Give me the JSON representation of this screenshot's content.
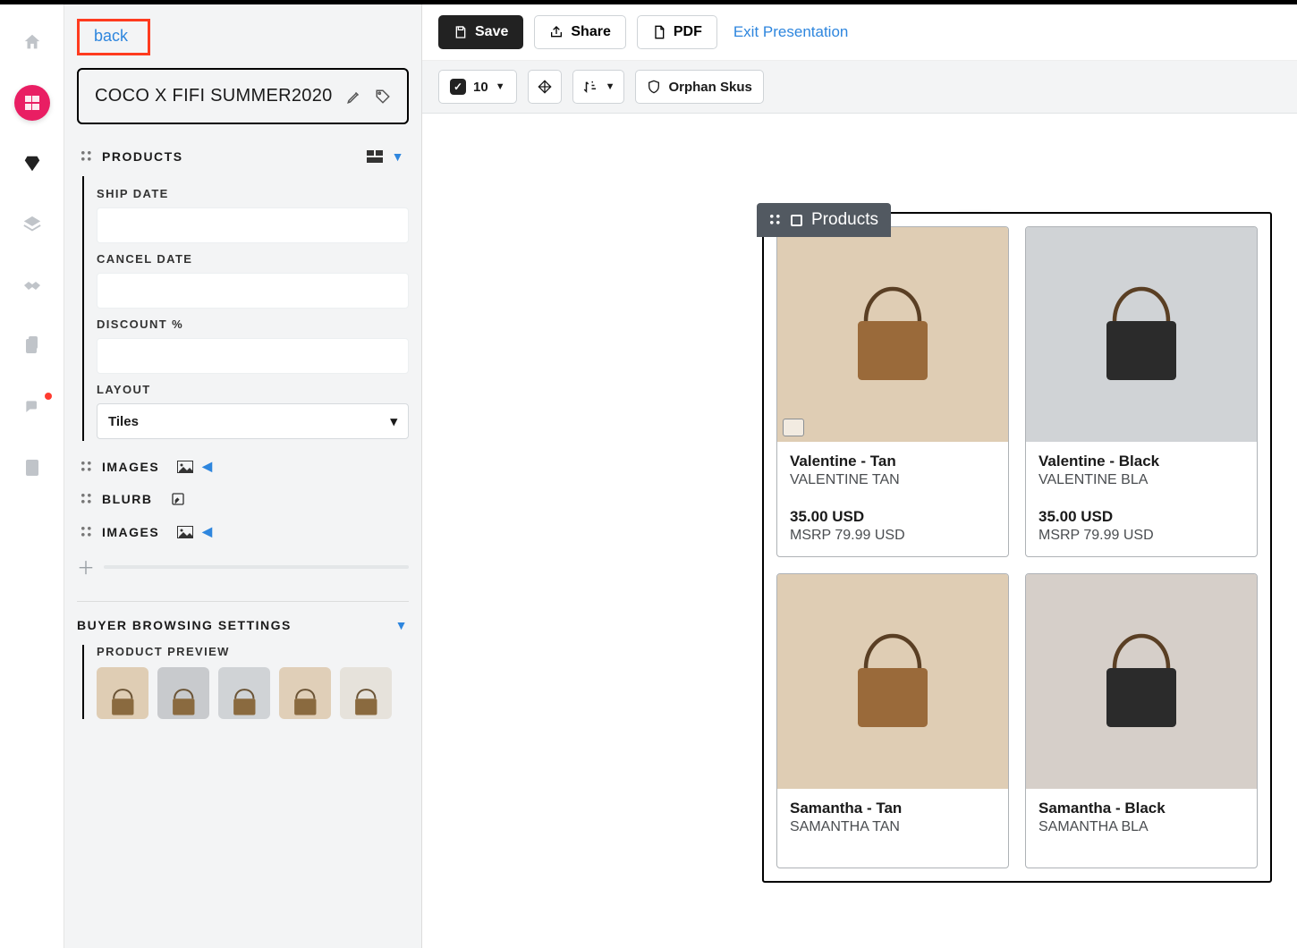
{
  "rail": {
    "items": [
      "home",
      "brand",
      "diamond",
      "layers",
      "handshake",
      "clipboard",
      "chat",
      "badge"
    ]
  },
  "sidebar": {
    "back": "back",
    "title": "COCO X FIFI SUMMER2020",
    "products_label": "PRODUCTS",
    "ship_date_label": "SHIP DATE",
    "ship_date_value": "",
    "cancel_date_label": "CANCEL DATE",
    "cancel_date_value": "",
    "discount_label": "DISCOUNT %",
    "discount_value": "",
    "layout_label": "LAYOUT",
    "layout_value": "Tiles",
    "images_label": "IMAGES",
    "blurb_label": "BLURB",
    "images2_label": "IMAGES",
    "buyer_label": "BUYER BROWSING SETTINGS",
    "preview_label": "PRODUCT PREVIEW"
  },
  "toolbar": {
    "save": "Save",
    "share": "Share",
    "pdf": "PDF",
    "exit": "Exit Presentation"
  },
  "subbar": {
    "count": "10",
    "orphan": "Orphan Skus"
  },
  "panel": {
    "tab_label": "Products",
    "cards": [
      {
        "title": "Valentine - Tan",
        "sku": "VALENTINE TAN",
        "price": "35.00 USD",
        "msrp": "MSRP 79.99 USD",
        "bg": "#dfcdb4"
      },
      {
        "title": "Valentine - Black",
        "sku": "VALENTINE BLA",
        "price": "35.00 USD",
        "msrp": "MSRP 79.99 USD",
        "bg": "#d0d3d6"
      },
      {
        "title": "Samantha - Tan",
        "sku": "SAMANTHA TAN",
        "price": "",
        "msrp": "",
        "bg": "#dfcdb4"
      },
      {
        "title": "Samantha - Black",
        "sku": "SAMANTHA BLA",
        "price": "",
        "msrp": "",
        "bg": "#d6cfc9"
      }
    ]
  },
  "thumbs": [
    "#dfcdb4",
    "#c8cacd",
    "#d0d3d6",
    "#e0cfb8",
    "#e6e2db"
  ]
}
